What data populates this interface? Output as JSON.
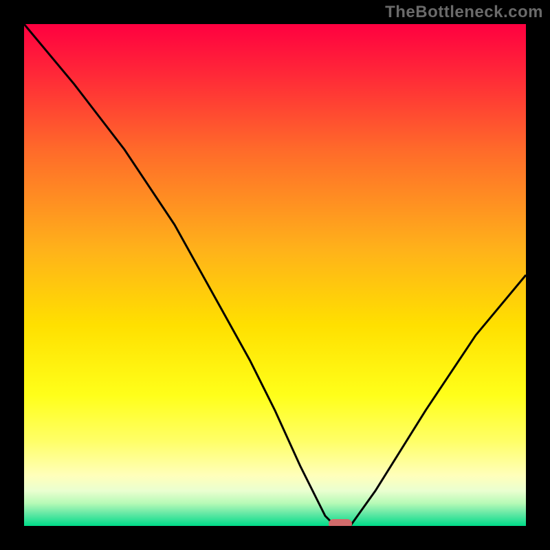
{
  "watermark": "TheBottleneck.com",
  "chart_data": {
    "type": "line",
    "title": "",
    "xlabel": "",
    "ylabel": "",
    "xlim": [
      0,
      100
    ],
    "ylim": [
      0,
      100
    ],
    "grid": false,
    "legend": false,
    "series": [
      {
        "name": "bottleneck-curve",
        "x": [
          0,
          10,
          20,
          30,
          40,
          45,
          50,
          55,
          60,
          62,
          65,
          70,
          80,
          90,
          100
        ],
        "values": [
          100,
          88,
          75,
          60,
          42,
          33,
          23,
          12,
          2,
          0,
          0,
          7,
          23,
          38,
          50
        ]
      }
    ],
    "marker": {
      "name": "optimal-point",
      "x": 63,
      "y": 0,
      "color": "#d16b6b"
    },
    "gradient_stops": [
      {
        "offset": 0.0,
        "color": "#ff0040"
      },
      {
        "offset": 0.1,
        "color": "#ff2838"
      },
      {
        "offset": 0.25,
        "color": "#ff6a2a"
      },
      {
        "offset": 0.45,
        "color": "#ffb21a"
      },
      {
        "offset": 0.6,
        "color": "#ffe000"
      },
      {
        "offset": 0.74,
        "color": "#ffff1a"
      },
      {
        "offset": 0.83,
        "color": "#ffff66"
      },
      {
        "offset": 0.9,
        "color": "#ffffbb"
      },
      {
        "offset": 0.93,
        "color": "#eaffd0"
      },
      {
        "offset": 0.955,
        "color": "#b6fab6"
      },
      {
        "offset": 0.975,
        "color": "#66e8a6"
      },
      {
        "offset": 1.0,
        "color": "#00dc88"
      }
    ]
  }
}
